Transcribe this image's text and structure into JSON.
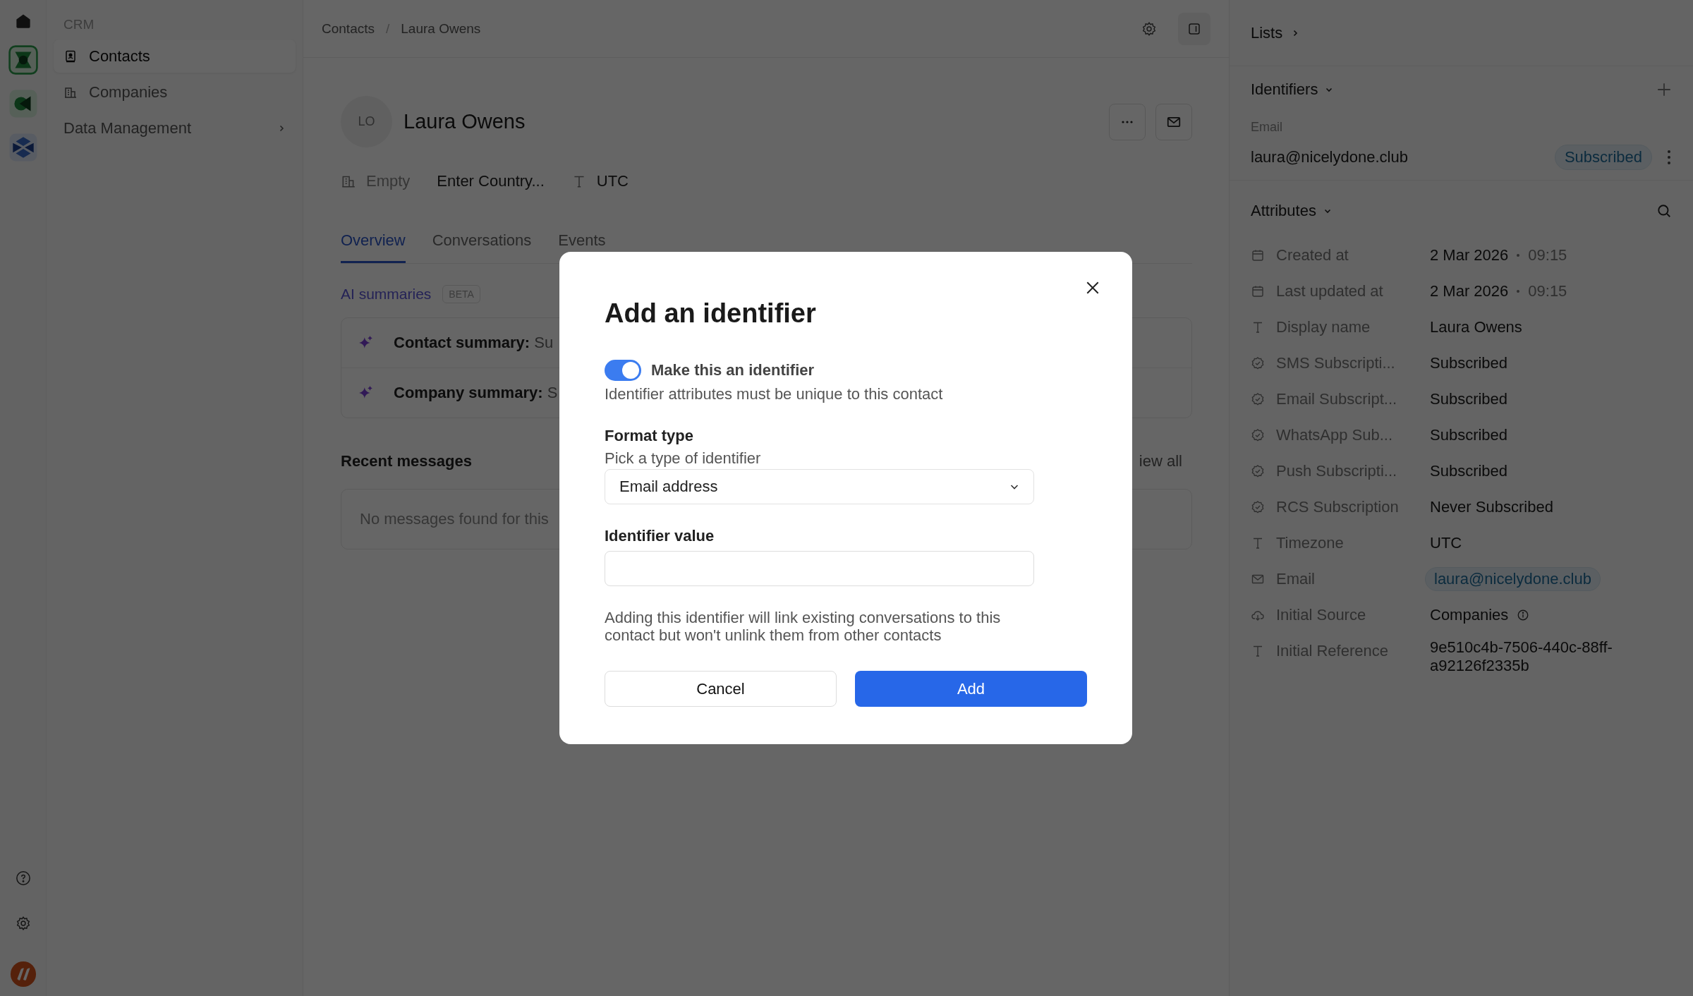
{
  "rail": {
    "apps": [
      {
        "kind": "home"
      },
      {
        "kind": "crm",
        "selected": true
      },
      {
        "kind": "video",
        "selected": false
      },
      {
        "kind": "cube",
        "selected": false
      }
    ],
    "bottom": [
      {
        "kind": "help"
      },
      {
        "kind": "settings"
      },
      {
        "kind": "brand"
      }
    ]
  },
  "sidebar": {
    "section": "CRM",
    "items": [
      {
        "label": "Contacts",
        "kind": "contacts",
        "selected": true
      },
      {
        "label": "Companies",
        "kind": "companies",
        "selected": false
      },
      {
        "label": "Data Management",
        "kind": "group",
        "selected": false
      }
    ]
  },
  "breadcrumb": {
    "items": [
      "Contacts",
      "Laura Owens"
    ],
    "separator": "/"
  },
  "profile": {
    "initials": "LO",
    "name": "Laura Owens",
    "meta": [
      {
        "kind": "company",
        "text": "Empty",
        "muted": true
      },
      {
        "kind": "country",
        "text": "Enter Country...",
        "muted": false
      },
      {
        "kind": "timezone",
        "text": "UTC",
        "muted": false
      }
    ]
  },
  "tabs": [
    {
      "label": "Overview",
      "selected": true
    },
    {
      "label": "Conversations",
      "selected": false
    },
    {
      "label": "Events",
      "selected": false
    }
  ],
  "ai_summaries": {
    "title": "AI summaries",
    "badge": "BETA",
    "rows": [
      {
        "label": "Contact summary:",
        "value": "Su"
      },
      {
        "label": "Company summary:",
        "value": "S"
      }
    ]
  },
  "recent_messages": {
    "title": "Recent messages",
    "link": "iew all",
    "empty": "No messages found for this"
  },
  "right_panel": {
    "lists": "Lists",
    "identifiers": {
      "title": "Identifiers",
      "items": [
        {
          "label": "Email",
          "value": "laura@nicelydone.club",
          "status": "Subscribed"
        }
      ]
    },
    "attributes": {
      "title": "Attributes",
      "rows": [
        {
          "kind": "date",
          "label": "Created at",
          "value": "2 Mar 2026",
          "time": "09:15"
        },
        {
          "kind": "date",
          "label": "Last updated at",
          "value": "2 Mar 2026",
          "time": "09:15"
        },
        {
          "kind": "text",
          "label": "Display name",
          "value": "Laura Owens"
        },
        {
          "kind": "status",
          "label": "SMS Subscripti...",
          "value": "Subscribed"
        },
        {
          "kind": "status",
          "label": "Email Subscript...",
          "value": "Subscribed"
        },
        {
          "kind": "status",
          "label": "WhatsApp Sub...",
          "value": "Subscribed"
        },
        {
          "kind": "status",
          "label": "Push Subscripti...",
          "value": "Subscribed"
        },
        {
          "kind": "status",
          "label": "RCS Subscription",
          "value": "Never Subscribed"
        },
        {
          "kind": "text",
          "label": "Timezone",
          "value": "UTC"
        },
        {
          "kind": "email",
          "label": "Email",
          "value": "laura@nicelydone.club"
        },
        {
          "kind": "source",
          "label": "Initial Source",
          "value": "Companies"
        },
        {
          "kind": "text",
          "label": "Initial Reference",
          "value": "9e510c4b-7506-440c-88ff-a92126f2335b"
        }
      ]
    }
  },
  "modal": {
    "title": "Add an identifier",
    "toggle": {
      "label": "Make this an identifier",
      "on": true
    },
    "toggle_hint": "Identifier attributes must be unique to this contact",
    "format": {
      "label": "Format type",
      "hint": "Pick a type of identifier",
      "value": "Email address"
    },
    "identifier_value": {
      "label": "Identifier value"
    },
    "note": "Adding this identifier will link existing conversations to this contact but won't unlink them from other contacts",
    "buttons": [
      {
        "label": "Cancel",
        "kind": "secondary"
      },
      {
        "label": "Add",
        "kind": "primary"
      }
    ]
  }
}
